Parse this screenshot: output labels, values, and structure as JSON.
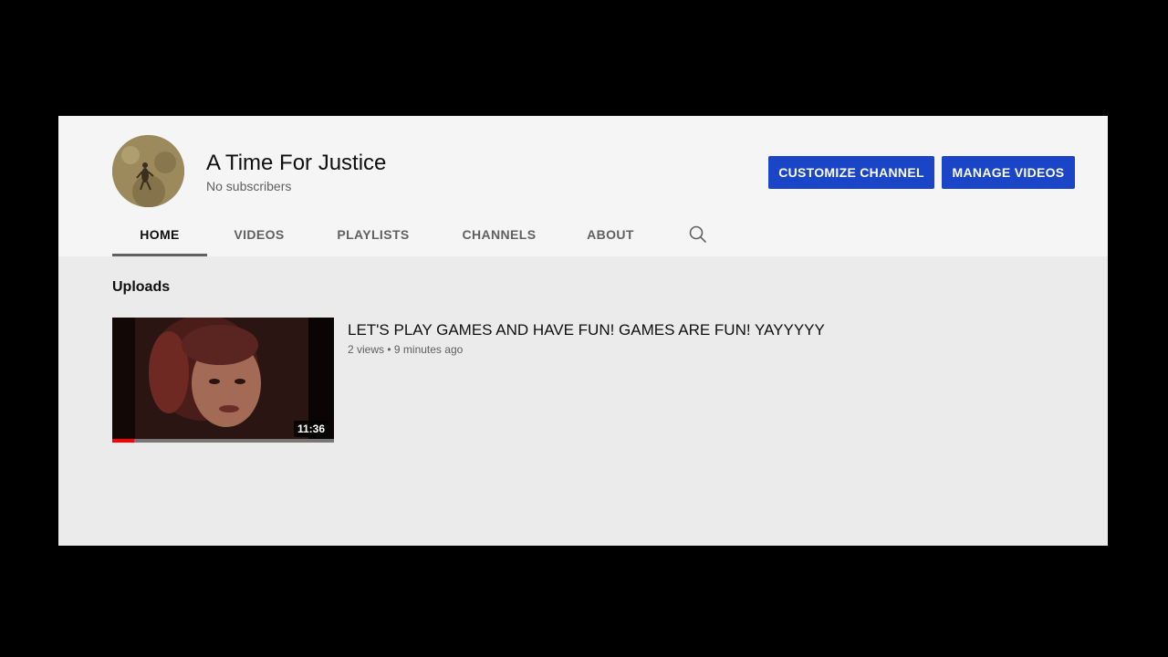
{
  "channel": {
    "name": "A Time For Justice",
    "subscribers": "No subscribers",
    "avatar_icon": "channel-avatar"
  },
  "header": {
    "customize_label": "CUSTOMIZE CHANNEL",
    "manage_label": "MANAGE VIDEOS"
  },
  "tabs": [
    {
      "label": "HOME",
      "active": true
    },
    {
      "label": "VIDEOS",
      "active": false
    },
    {
      "label": "PLAYLISTS",
      "active": false
    },
    {
      "label": "CHANNELS",
      "active": false
    },
    {
      "label": "ABOUT",
      "active": false
    }
  ],
  "search_icon": "search-icon",
  "uploads": {
    "section_title": "Uploads",
    "videos": [
      {
        "title": "LET'S PLAY GAMES AND HAVE FUN! GAMES ARE FUN! YAYYYYY",
        "views": "2 views",
        "separator": "•",
        "age": "9 minutes ago",
        "duration": "11:36",
        "watched_fraction": 0.1
      }
    ]
  },
  "colors": {
    "page_bg": "#000000",
    "header_bg": "#f5f5f5",
    "content_bg": "#ebebeb",
    "button_blue": "#1a45c6",
    "progress_red": "#ff0000"
  }
}
